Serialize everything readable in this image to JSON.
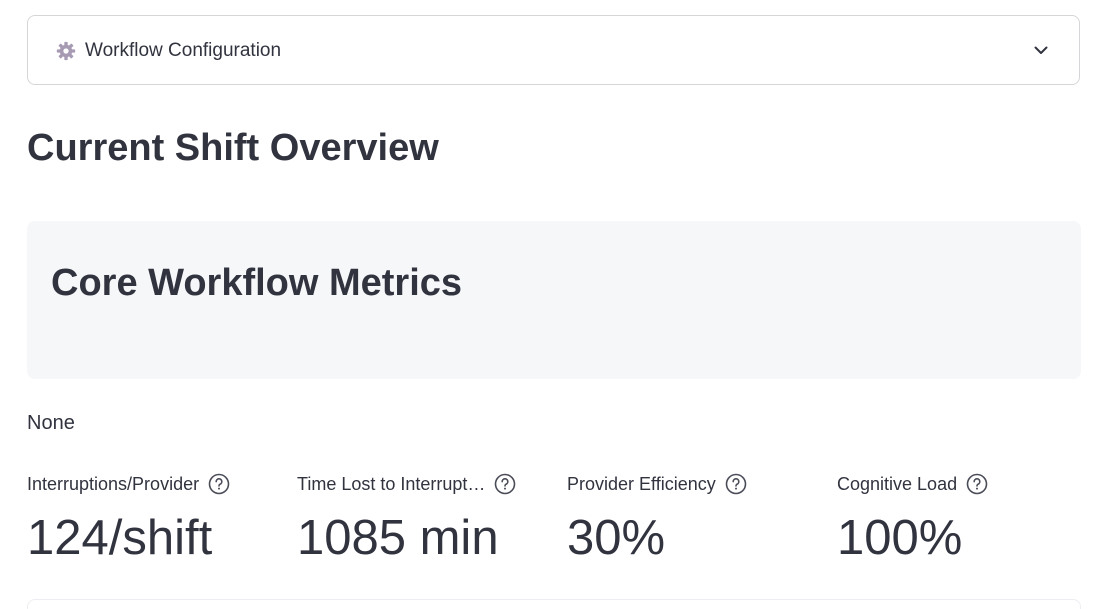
{
  "expander": {
    "icon": "gear-icon",
    "label": "Workflow Configuration",
    "chevron_icon": "chevron-down-icon"
  },
  "header": {
    "title": "Current Shift Overview"
  },
  "card": {
    "title": "Core Workflow Metrics"
  },
  "status_text": "None",
  "metrics": [
    {
      "label": "Interruptions/Provider",
      "value": "124/shift"
    },
    {
      "label": "Time Lost to Interrupt…",
      "value": "1085 min"
    },
    {
      "label": "Provider Efficiency",
      "value": "30%"
    },
    {
      "label": "Cognitive Load",
      "value": "100%"
    }
  ],
  "colors": {
    "text": "#31333f",
    "border": "#d6d6d9",
    "card_bg": "#f6f7f9",
    "gear": "#a79bb3"
  }
}
